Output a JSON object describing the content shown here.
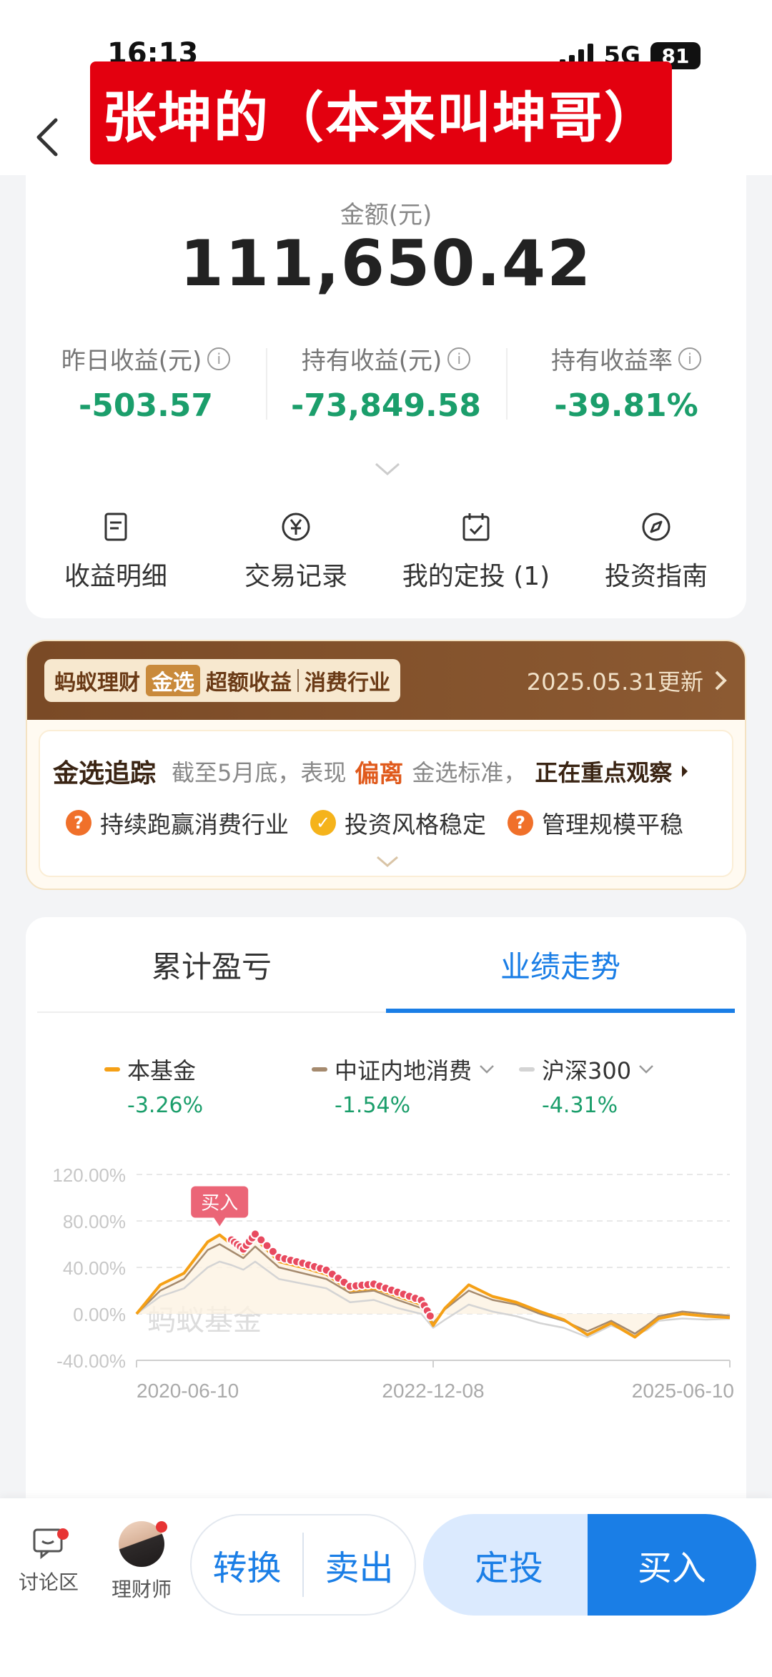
{
  "status": {
    "time": "16:13",
    "network": "5G",
    "battery": "81"
  },
  "header": {
    "banner": "张坤的（本来叫坤哥）"
  },
  "summary": {
    "amount_label": "金额(元)",
    "amount": "111,650.42",
    "stats": [
      {
        "label": "昨日收益(元)",
        "value": "-503.57"
      },
      {
        "label": "持有收益(元)",
        "value": "-73,849.58"
      },
      {
        "label": "持有收益率",
        "value": "-39.81%"
      }
    ],
    "actions": [
      {
        "label": "收益明细",
        "icon": "document-icon"
      },
      {
        "label": "交易记录",
        "icon": "yen-icon"
      },
      {
        "label": "我的定投 (1)",
        "icon": "calendar-check-icon"
      },
      {
        "label": "投资指南",
        "icon": "compass-icon"
      }
    ]
  },
  "promo": {
    "brand": "蚂蚁理财",
    "brand_gold": "金选",
    "tag1": "超额收益",
    "tag2": "消费行业",
    "date": "2025.05.31更新",
    "track_title": "金选追踪",
    "track_pre": "截至5月底，表现",
    "track_highlight": "偏离",
    "track_post": "金选标准，",
    "track_watch": "正在重点观察",
    "badges": [
      {
        "label": "持续跑赢消费行业",
        "type": "question"
      },
      {
        "label": "投资风格稳定",
        "type": "check"
      },
      {
        "label": "管理规模平稳",
        "type": "question"
      }
    ]
  },
  "chart_tabs": {
    "tab1": "累计盈亏",
    "tab2": "业绩走势"
  },
  "legend": [
    {
      "name": "本基金",
      "value": "-3.26%",
      "color": "#f5a016"
    },
    {
      "name": "中证内地消费",
      "value": "-1.54%",
      "color": "#a58a6e"
    },
    {
      "name": "沪深300",
      "value": "-4.31%",
      "color": "#d4d4d4"
    }
  ],
  "chart_data": {
    "type": "line",
    "title": "",
    "xlabel": "",
    "ylabel": "",
    "ylim": [
      -40,
      120
    ],
    "y_ticks": [
      "120.00%",
      "80.00%",
      "40.00%",
      "0.00%",
      "-40.00%"
    ],
    "x_ticks": [
      "2020-06-10",
      "2022-12-08",
      "2025-06-10"
    ],
    "watermark": "蚂蚁基金",
    "buy_marker_label": "买入",
    "x": [
      0,
      0.04,
      0.08,
      0.12,
      0.14,
      0.16,
      0.18,
      0.2,
      0.24,
      0.28,
      0.32,
      0.36,
      0.4,
      0.44,
      0.48,
      0.5,
      0.52,
      0.56,
      0.6,
      0.64,
      0.68,
      0.72,
      0.76,
      0.8,
      0.84,
      0.86,
      0.88,
      0.92,
      0.96,
      1.0
    ],
    "series": [
      {
        "name": "本基金",
        "values": [
          0,
          25,
          35,
          62,
          68,
          60,
          52,
          65,
          45,
          40,
          34,
          20,
          22,
          15,
          8,
          -10,
          5,
          25,
          15,
          10,
          2,
          -5,
          -18,
          -8,
          -20,
          -12,
          -4,
          0,
          -2,
          -3.26
        ]
      },
      {
        "name": "中证内地消费",
        "values": [
          0,
          20,
          30,
          55,
          60,
          54,
          48,
          58,
          40,
          35,
          30,
          18,
          20,
          12,
          5,
          -8,
          4,
          20,
          12,
          8,
          0,
          -6,
          -15,
          -6,
          -17,
          -10,
          -2,
          2,
          0,
          -1.54
        ]
      },
      {
        "name": "沪深300",
        "values": [
          0,
          15,
          22,
          40,
          45,
          42,
          38,
          45,
          30,
          26,
          22,
          10,
          12,
          5,
          0,
          -12,
          -5,
          8,
          2,
          -2,
          -8,
          -12,
          -20,
          -10,
          -18,
          -14,
          -6,
          -4,
          -5,
          -4.31
        ]
      }
    ]
  },
  "bottom": {
    "forum": "讨论区",
    "advisor": "理财师",
    "convert": "转换",
    "sell": "卖出",
    "invest": "定投",
    "buy": "买入"
  }
}
